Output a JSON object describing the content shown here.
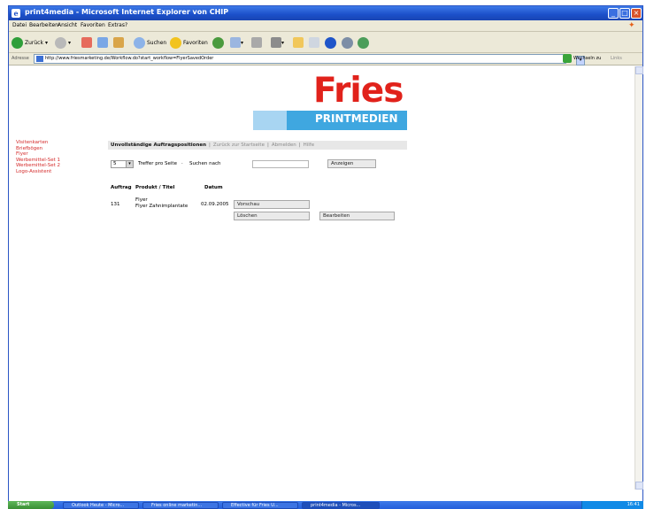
{
  "window": {
    "title": "print4media - Microsoft Internet Explorer von CHIP"
  },
  "menubar": {
    "items": [
      "Datei",
      "Bearbeiten",
      "Ansicht",
      "Favoriten",
      "Extras",
      "?"
    ]
  },
  "toolbar": {
    "back_label": "Zurück",
    "search_label": "Suchen",
    "favorites_label": "Favoriten"
  },
  "addressbar": {
    "label": "Adresse",
    "url": "http://www.friesmarketing.de/Workflow.do?start_workflow=FlyerSavedOrder",
    "go_label": "Wechseln zu",
    "links_label": "Links"
  },
  "logo": {
    "word": "Fries",
    "sub": "PRINTMEDIEN"
  },
  "leftnav": {
    "items": [
      "Visitenkarten",
      "Briefbögen",
      "Flyer",
      "Werbemittel-Set 1",
      "Werbemittel-Set 2",
      "Logo-Assistent"
    ]
  },
  "tabs": {
    "active": "Unvollständige Auftragspositionen",
    "items": [
      "Zurück zur Startseite",
      "Abmelden",
      "Hilfe"
    ]
  },
  "filter": {
    "per_page_value": "5",
    "per_page_label": "Treffer pro Seite",
    "search_label": "Suchen nach",
    "search_value": "",
    "show_button": "Anzeigen"
  },
  "table": {
    "headers": [
      "Auftrag",
      "Produkt / Titel",
      "Datum"
    ],
    "rows": [
      {
        "order": "131",
        "product": "Flyer",
        "title": "Flyer Zahnimplantate",
        "date": "02.09.2005",
        "preview_button": "Vorschau",
        "delete_button": "Löschen",
        "edit_button": "Bearbeiten"
      }
    ]
  },
  "taskbar": {
    "start_label": "Start",
    "tasks": [
      "Outlook Heute - Micro...",
      "Fries online marketin...",
      "Effective für Fries U...",
      "print4media - Micros..."
    ],
    "clock": "16:41"
  },
  "colors": {
    "brand_red": "#e1221b",
    "brand_blue": "#3fa7e0",
    "nav_red": "#d42a2a",
    "xp_blue": "#245edb"
  }
}
